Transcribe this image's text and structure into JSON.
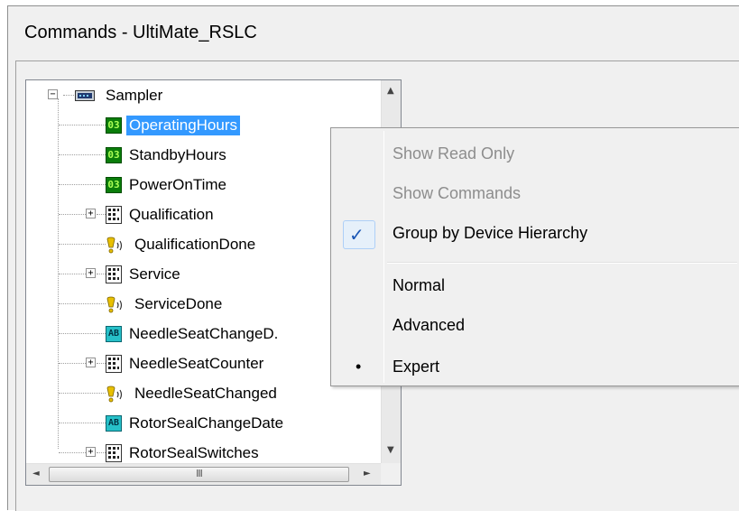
{
  "window": {
    "title": "Commands - UltiMate_RSLC"
  },
  "tree": {
    "root": {
      "label": "Sampler",
      "icon": "device-icon",
      "expander": "−"
    },
    "items": [
      {
        "label": "OperatingHours",
        "icon": "numeric-value-icon",
        "icon_text": "03",
        "selected": true,
        "expander": null
      },
      {
        "label": "StandbyHours",
        "icon": "numeric-value-icon",
        "icon_text": "03",
        "expander": null
      },
      {
        "label": "PowerOnTime",
        "icon": "numeric-value-icon",
        "icon_text": "03",
        "expander": null
      },
      {
        "label": "Qualification",
        "icon": "group-grid-icon",
        "expander": "+"
      },
      {
        "label": "QualificationDone",
        "icon": "alert-signal-icon",
        "expander": null
      },
      {
        "label": "Service",
        "icon": "group-grid-icon",
        "expander": "+"
      },
      {
        "label": "ServiceDone",
        "icon": "alert-signal-icon",
        "expander": null
      },
      {
        "label": "NeedleSeatChangeD.",
        "icon": "string-value-icon",
        "icon_text": "AB",
        "expander": null
      },
      {
        "label": "NeedleSeatCounter",
        "icon": "group-grid-icon",
        "expander": "+"
      },
      {
        "label": "NeedleSeatChanged",
        "icon": "alert-signal-icon",
        "expander": null
      },
      {
        "label": "RotorSealChangeDate",
        "icon": "string-value-icon",
        "icon_text": "AB",
        "expander": null
      },
      {
        "label": "RotorSealSwitches",
        "icon": "group-grid-icon",
        "expander": "+"
      }
    ]
  },
  "scrollbars": {
    "up_arrow": "▲",
    "down_arrow": "▼",
    "left_arrow": "◄",
    "right_arrow": "►",
    "thumb_grip": "III"
  },
  "context_menu": {
    "items": [
      {
        "label": "Show Read Only",
        "enabled": false
      },
      {
        "label": "Show Commands",
        "enabled": false
      },
      {
        "label": "Group by Device Hierarchy",
        "enabled": true,
        "checked": true,
        "check_glyph": "✓"
      },
      {
        "label": "Normal",
        "enabled": true
      },
      {
        "label": "Advanced",
        "enabled": true
      },
      {
        "label": "Expert",
        "enabled": true,
        "radio_selected": true,
        "bullet_glyph": "•"
      }
    ]
  },
  "colors": {
    "selection": "#3399ff",
    "numeric_icon_bg": "#0a7d0a",
    "string_icon_bg": "#27c0c8",
    "alert_icon": "#e8c000",
    "checkmark": "#1a56b5"
  }
}
